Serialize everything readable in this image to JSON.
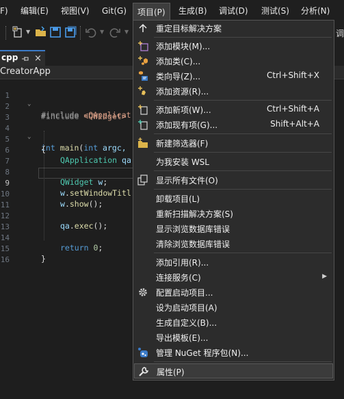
{
  "menubar": {
    "items": [
      {
        "label": "F)"
      },
      {
        "label": "编辑(E)"
      },
      {
        "label": "视图(V)"
      },
      {
        "label": "Git(G)"
      },
      {
        "label": "项目(P)"
      },
      {
        "label": "生成(B)"
      },
      {
        "label": "调试(D)"
      },
      {
        "label": "测试(S)"
      },
      {
        "label": "分析(N)"
      }
    ]
  },
  "toolbar": {
    "right_text": "调"
  },
  "tab": {
    "label": "cpp",
    "close": "×"
  },
  "nav": {
    "project": "CreatorApp"
  },
  "editor": {
    "line_numbers": [
      "1",
      "2",
      "3",
      "4",
      "5",
      "6",
      "7",
      "8",
      "9",
      "10",
      "11",
      "12",
      "13",
      "14",
      "15",
      "16"
    ],
    "current_line": "9",
    "lines": {
      "l1_pp": "#include ",
      "l1_inc": "<QApplicat",
      "l2_pp": "#include ",
      "l2_inc": "<QWidget>",
      "l4_kw": "int",
      "l4_fn": " main",
      "l4_rest": "(",
      "l4_kw2": "int",
      "l4_var": " argc,",
      "l5": "{",
      "l6_ty": "QApplication",
      "l6_var": " qa",
      "l8_ty": "QWidget",
      "l8_var": " w",
      "l8_rest": ";",
      "l9_var": "w",
      "l9_rest": ".",
      "l9_fn": "setWindowTitl",
      "l10_var": "w",
      "l10_rest": ".",
      "l10_fn": "show",
      "l10_rest2": "();",
      "l12_var": "qa",
      "l12_rest": ".",
      "l12_fn": "exec",
      "l12_rest2": "();",
      "l14_kw": "return",
      "l14_num": " 0",
      "l14_rest": ";",
      "l15": "}"
    }
  },
  "project_menu": {
    "items": [
      {
        "label": "重定目标解决方案",
        "shortcut": "",
        "icon": "retarget-arrow-icon"
      },
      {
        "label": "添加模块(M)...",
        "shortcut": "",
        "icon": "add-module-icon"
      },
      {
        "label": "添加类(C)...",
        "shortcut": "",
        "icon": "add-class-icon"
      },
      {
        "label": "类向导(Z)...",
        "shortcut": "Ctrl+Shift+X",
        "icon": "class-wizard-icon"
      },
      {
        "label": "添加资源(R)...",
        "shortcut": "",
        "icon": "add-resource-icon"
      },
      {
        "label": "添加新项(W)...",
        "shortcut": "Ctrl+Shift+A",
        "icon": "add-new-item-icon"
      },
      {
        "label": "添加现有项(G)...",
        "shortcut": "Shift+Alt+A",
        "icon": "add-existing-item-icon"
      },
      {
        "label": "新建筛选器(F)",
        "shortcut": "",
        "icon": "new-filter-icon"
      },
      {
        "label": "为我安装 WSL",
        "shortcut": "",
        "icon": ""
      },
      {
        "label": "显示所有文件(O)",
        "shortcut": "",
        "icon": "show-all-files-icon"
      },
      {
        "label": "卸载项目(L)",
        "shortcut": "",
        "icon": ""
      },
      {
        "label": "重新扫描解决方案(S)",
        "shortcut": "",
        "icon": ""
      },
      {
        "label": "显示浏览数据库错误",
        "shortcut": "",
        "icon": ""
      },
      {
        "label": "清除浏览数据库错误",
        "shortcut": "",
        "icon": ""
      },
      {
        "label": "添加引用(R)...",
        "shortcut": "",
        "icon": ""
      },
      {
        "label": "连接服务(C)",
        "shortcut": "",
        "icon": "",
        "submenu": "▶"
      },
      {
        "label": "配置启动项目...",
        "shortcut": "",
        "icon": "gear-icon"
      },
      {
        "label": "设为启动项目(A)",
        "shortcut": "",
        "icon": ""
      },
      {
        "label": "生成自定义(B)...",
        "shortcut": "",
        "icon": ""
      },
      {
        "label": "导出模板(E)...",
        "shortcut": "",
        "icon": ""
      },
      {
        "label": "管理 NuGet 程序包(N)...",
        "shortcut": "",
        "icon": "nuget-icon"
      },
      {
        "label": "属性(P)",
        "shortcut": "",
        "icon": "wrench-icon"
      }
    ]
  }
}
